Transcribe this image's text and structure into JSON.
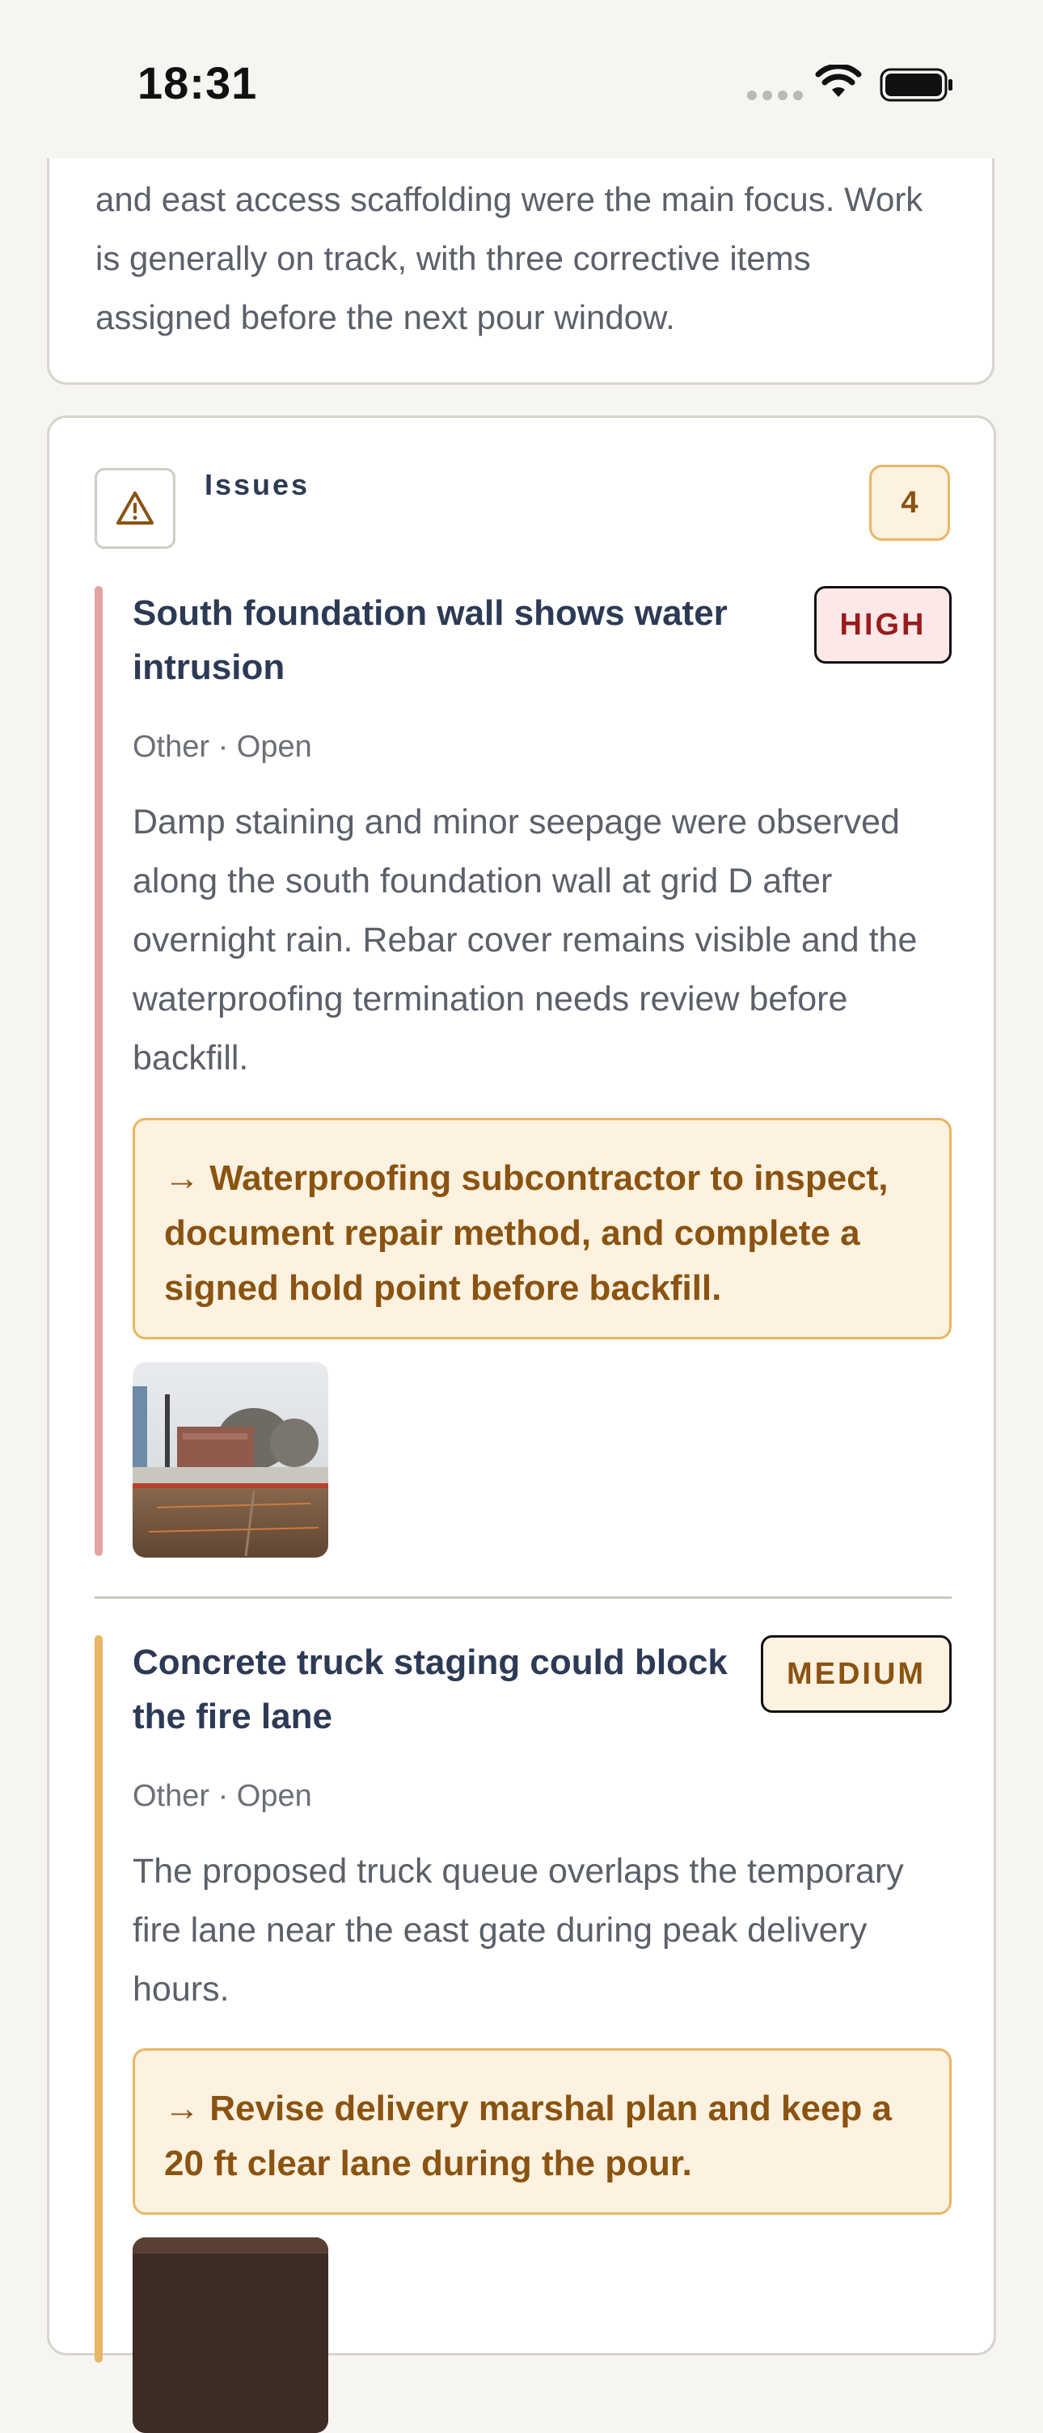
{
  "status_bar": {
    "time": "18:31"
  },
  "summary": {
    "text": "and east access scaffolding were the main focus. Work is generally on track, with three corrective items assigned before the next pour window."
  },
  "issues": {
    "title": "Issues",
    "count": "4",
    "items": [
      {
        "title": "South foundation wall shows water intrusion",
        "severity": "HIGH",
        "severity_bg": "#fde8e8",
        "severity_color": "#9b1c1c",
        "accent_color": "#e3a3a3",
        "meta": "Other · Open",
        "description": "Damp staining and minor seepage were observed along the south foundation wall at grid D after overnight rain. Rebar cover remains visible and the waterproofing termination needs review before backfill.",
        "action": "→ Waterproofing subcontractor to inspect, document repair method, and complete a signed hold point before backfill."
      },
      {
        "title": "Concrete truck staging could block the fire lane",
        "severity": "MEDIUM",
        "severity_bg": "#fdf1df",
        "severity_color": "#8a5311",
        "accent_color": "#e8b665",
        "meta": "Other · Open",
        "description": "The proposed truck queue overlaps the temporary fire lane near the east gate during peak delivery hours.",
        "action": "→ Revise delivery marshal plan and keep a 20 ft clear lane during the pour."
      }
    ]
  }
}
